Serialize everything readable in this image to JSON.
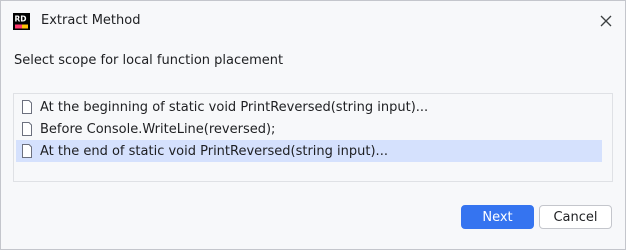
{
  "dialog": {
    "title": "Extract Method",
    "app_icon": "rider-logo-icon",
    "app_icon_text": "RD",
    "close_icon": "close-icon"
  },
  "prompt": "Select scope for local function placement",
  "options": [
    {
      "label": "At the beginning of static void PrintReversed(string input)...",
      "icon": "file-icon",
      "selected": false
    },
    {
      "label": "Before Console.WriteLine(reversed);",
      "icon": "file-icon",
      "selected": false
    },
    {
      "label": "At the end of static void PrintReversed(string input)...",
      "icon": "file-icon",
      "selected": true
    }
  ],
  "buttons": {
    "next": "Next",
    "cancel": "Cancel"
  },
  "colors": {
    "accent": "#3574f0",
    "selection": "#d5e1fd"
  }
}
